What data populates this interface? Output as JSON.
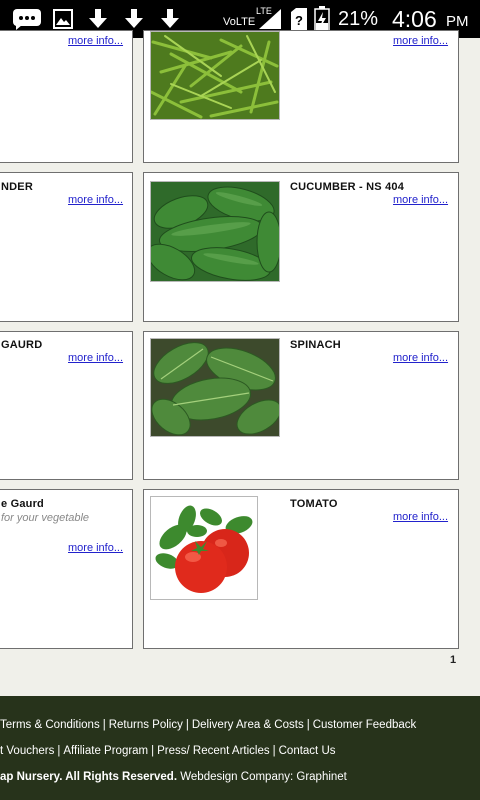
{
  "status_bar": {
    "volte": "VoLTE",
    "lte": "LTE",
    "battery": "21%",
    "time": "4:06",
    "ampm": "PM"
  },
  "products": {
    "left": [
      {
        "title": "",
        "link": "more info..."
      },
      {
        "title": "NDER",
        "link": "more info..."
      },
      {
        "title": "GAURD",
        "link": "more info..."
      },
      {
        "title": "e Gaurd",
        "subtitle": "for your vegetable",
        "link": "more info..."
      }
    ],
    "right": [
      {
        "title": "",
        "link": "more info...",
        "icon": "green-beans-image"
      },
      {
        "title": "CUCUMBER - NS 404",
        "link": "more info...",
        "icon": "cucumber-image"
      },
      {
        "title": "SPINACH",
        "link": "more info...",
        "icon": "spinach-image"
      },
      {
        "title": "TOMATO",
        "link": "more info...",
        "icon": "tomato-image"
      }
    ]
  },
  "pagination": {
    "current": "1"
  },
  "footer": {
    "line1": [
      "Terms & Conditions",
      "Returns Policy",
      "Delivery Area & Costs",
      "Customer Feedback"
    ],
    "line2": [
      "t Vouchers",
      "Affiliate Program",
      "Press/ Recent Articles",
      "Contact Us"
    ],
    "line3_bold": "ap Nursery. All Rights Reserved.",
    "line3_text": "Webdesign Company: Graphinet"
  },
  "colors": {
    "footer_bg": "#27331b",
    "link": "#2222cc",
    "page_bg": "#f0f0ea"
  }
}
